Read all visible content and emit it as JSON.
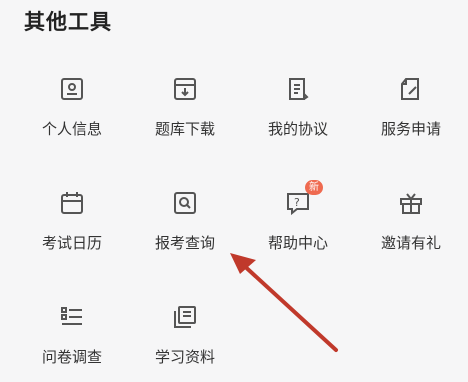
{
  "section": {
    "title": "其他工具"
  },
  "tools": [
    {
      "label": "个人信息",
      "icon": "id-card-icon"
    },
    {
      "label": "题库下载",
      "icon": "download-box-icon"
    },
    {
      "label": "我的协议",
      "icon": "document-icon"
    },
    {
      "label": "服务申请",
      "icon": "edit-file-icon"
    },
    {
      "label": "考试日历",
      "icon": "calendar-icon"
    },
    {
      "label": "报考查询",
      "icon": "search-doc-icon"
    },
    {
      "label": "帮助中心",
      "icon": "help-chat-icon",
      "badge": "新"
    },
    {
      "label": "邀请有礼",
      "icon": "gift-icon"
    },
    {
      "label": "问卷调查",
      "icon": "list-icon"
    },
    {
      "label": "学习资料",
      "icon": "copy-icon"
    }
  ],
  "colors": {
    "icon": "#555555",
    "badge": "#ef6a50",
    "arrow": "#c0392b"
  }
}
